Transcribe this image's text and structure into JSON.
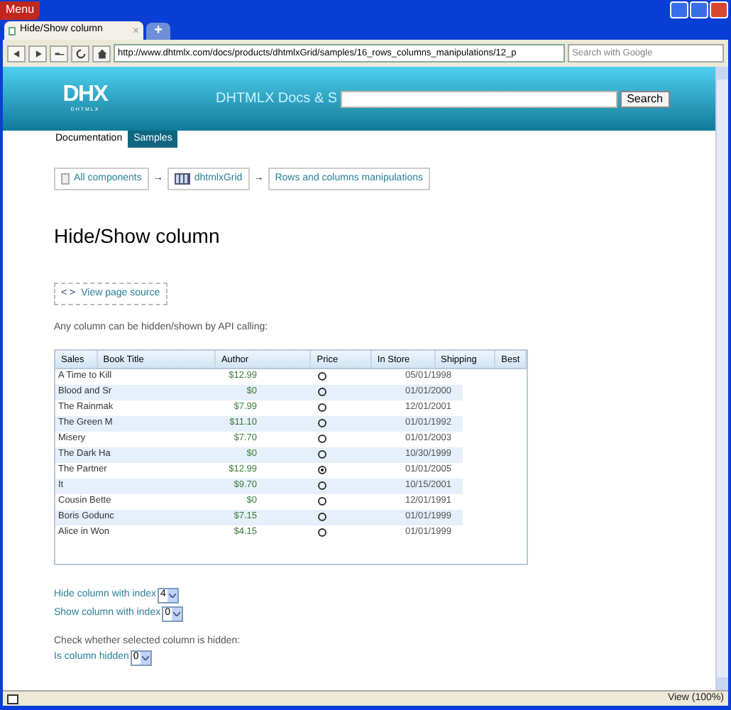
{
  "browser": {
    "menu_label": "Menu",
    "tabs": [
      {
        "label": "Hide/Show column",
        "close": "×",
        "selected": true
      }
    ],
    "new_tab": "+",
    "address": "http://www.dhtmlx.com/docs/products/dhtmlxGrid/samples/16_rows_columns_manipulations/12_p",
    "search_placeholder": "Search with Google",
    "status": "View (100%)"
  },
  "header": {
    "logo": "DHX",
    "logo_sub": "DHTMLX",
    "site_title": "DHTMLX Docs & S",
    "search_button": "Search"
  },
  "nav": [
    {
      "label": "Documentation",
      "selected": false
    },
    {
      "label": "Samples",
      "selected": true
    }
  ],
  "breadcrumbs": [
    {
      "label": "All components",
      "kind": "page"
    },
    {
      "label": "dhtmlxGrid",
      "kind": "grid"
    },
    {
      "label": "Rows and columns manipulations",
      "kind": "plain"
    }
  ],
  "breadcrumb_separator": "→",
  "title": "Hide/Show column",
  "source_link": {
    "icon": "< >",
    "label": "View page source"
  },
  "intro": "Any column can be hidden/shown by API calling:",
  "grid": {
    "columns": [
      "Sales",
      "Book Title",
      "Author",
      "Price",
      "In Store",
      "Shipping",
      "Best"
    ],
    "rows": [
      {
        "title": "A Time to Kill",
        "price": "$12.99",
        "selected": false,
        "date": "05/01/1998"
      },
      {
        "title": "Blood and Sr",
        "price": "$0",
        "selected": false,
        "date": "01/01/2000"
      },
      {
        "title": "The Rainmak",
        "price": "$7.99",
        "selected": false,
        "date": "12/01/2001"
      },
      {
        "title": "The Green M",
        "price": "$11.10",
        "selected": false,
        "date": "01/01/1992"
      },
      {
        "title": "Misery",
        "price": "$7.70",
        "selected": false,
        "date": "01/01/2003"
      },
      {
        "title": "The Dark Ha",
        "price": "$0",
        "selected": false,
        "date": "10/30/1999"
      },
      {
        "title": "The Partner",
        "price": "$12.99",
        "selected": true,
        "date": "01/01/2005"
      },
      {
        "title": "It",
        "price": "$9.70",
        "selected": false,
        "date": "10/15/2001"
      },
      {
        "title": "Cousin Bette",
        "price": "$0",
        "selected": false,
        "date": "12/01/1991"
      },
      {
        "title": "Boris Godunc",
        "price": "$7.15",
        "selected": false,
        "date": "01/01/1999"
      },
      {
        "title": "Alice in Won",
        "price": "$4.15",
        "selected": false,
        "date": "01/01/1999"
      }
    ]
  },
  "controls": [
    {
      "kind": "select",
      "label": "Hide column with index",
      "value": "4"
    },
    {
      "kind": "select",
      "label": "Show column with index",
      "value": "0"
    },
    {
      "kind": "note",
      "label": "Check whether selected column is hidden:"
    },
    {
      "kind": "select",
      "label": "Is column hidden",
      "value": "0"
    }
  ]
}
